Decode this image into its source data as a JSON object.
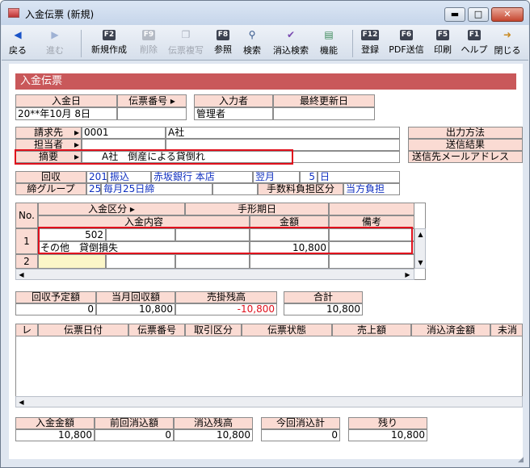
{
  "window": {
    "title": "入金伝票 (新規)",
    "btn_min": "▬",
    "btn_max": "□",
    "btn_close": "✕"
  },
  "toolbar": {
    "back": "戻る",
    "forward": "進む",
    "f2": "F2",
    "new": "新規作成",
    "f9": "F9",
    "delete": "削除",
    "copy": "伝票複写",
    "f8": "F8",
    "ref": "参照",
    "search": "検索",
    "match_search": "消込検索",
    "func": "機能",
    "f12": "F12",
    "register": "登録",
    "f6": "F6",
    "pdf": "PDF送信",
    "f5": "F5",
    "print": "印刷",
    "f1": "F1",
    "help": "ヘルプ",
    "close": "閉じる"
  },
  "section_title": "入金伝票",
  "header": {
    "date_label": "入金日",
    "date_value": "20**年10月 8日",
    "slip_label": "伝票番号",
    "slip_value": "",
    "entry_label": "入力者",
    "entry_value": "管理者",
    "updated_label": "最終更新日",
    "updated_value": ""
  },
  "billing": {
    "label": "請求先",
    "code": "0001",
    "name": "A社"
  },
  "staff": {
    "label": "担当者",
    "code": "",
    "name": ""
  },
  "summary": {
    "label": "摘要",
    "value": "A社　倒産による貸倒れ"
  },
  "output": {
    "method": "出力方法",
    "result": "送信結果",
    "email": "送信先メールアドレス"
  },
  "collection": {
    "label": "回収",
    "code": "201",
    "type": "振込",
    "bank": "赤坂銀行 本店",
    "month": "翌月",
    "day_num": "5",
    "day": "日"
  },
  "closing": {
    "label": "締グループ",
    "code": "25",
    "value": "毎月25日締",
    "fee_label": "手数料負担区分",
    "fee_value": "当方負担"
  },
  "detail": {
    "no_label": "No.",
    "type_label": "入金区分",
    "bill_date_label": "手形期日",
    "content_label": "入金内容",
    "amount_label": "金額",
    "note_label": "備考",
    "rows": [
      {
        "no": "1",
        "code": "502",
        "name": "その他　貸倒損失",
        "amount": "10,800"
      },
      {
        "no": "2",
        "code": "",
        "name": "",
        "amount": ""
      }
    ]
  },
  "totals1": {
    "planned_label": "回収予定額",
    "planned": "0",
    "month_label": "当月回収額",
    "month": "10,800",
    "ar_label": "売掛残高",
    "ar": "-10,800",
    "sum_label": "合計",
    "sum": "10,800"
  },
  "list": {
    "columns": [
      "レ",
      "伝票日付",
      "伝票番号",
      "取引区分",
      "伝票状態",
      "売上額",
      "消込済金額",
      "未消"
    ]
  },
  "totals2": {
    "deposit_label": "入金金額",
    "deposit": "10,800",
    "prev_label": "前回消込額",
    "prev": "0",
    "remain_label": "消込残高",
    "remain": "10,800",
    "now_label": "今回消込計",
    "now": "0",
    "rest_label": "残り",
    "rest": "10,800"
  }
}
